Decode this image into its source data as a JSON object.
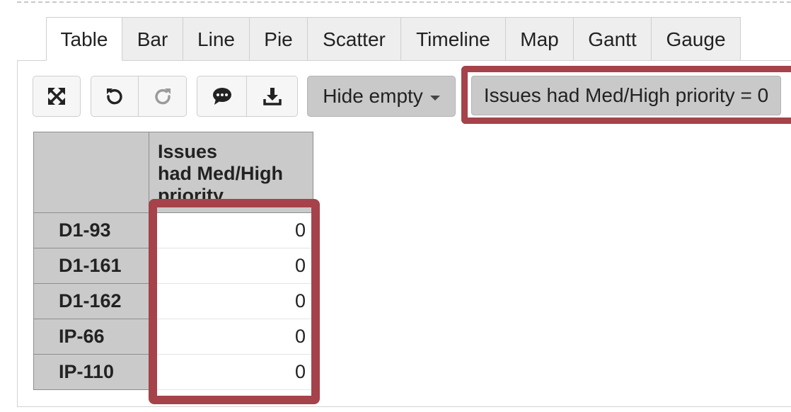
{
  "tabs": [
    {
      "label": "Table",
      "active": true
    },
    {
      "label": "Bar"
    },
    {
      "label": "Line"
    },
    {
      "label": "Pie"
    },
    {
      "label": "Scatter"
    },
    {
      "label": "Timeline"
    },
    {
      "label": "Map"
    },
    {
      "label": "Gantt"
    },
    {
      "label": "Gauge"
    }
  ],
  "toolbar": {
    "icons": [
      "fullscreen-icon",
      "undo-icon",
      "redo-icon",
      "comment-icon",
      "download-icon"
    ],
    "hide_empty_label": "Hide empty",
    "filter_label": "Issues had Med/High priority = 0"
  },
  "table": {
    "column_header": "Issues had Med/High priority",
    "column_header_lines": [
      "Issues",
      "had Med/High",
      "priority"
    ],
    "rows": [
      {
        "key": "D1-93",
        "value": "0"
      },
      {
        "key": "D1-161",
        "value": "0"
      },
      {
        "key": "D1-162",
        "value": "0"
      },
      {
        "key": "IP-66",
        "value": "0"
      },
      {
        "key": "IP-110",
        "value": "0"
      }
    ]
  },
  "colors": {
    "highlight": "#a5424a",
    "header_bg": "#cacaca"
  }
}
